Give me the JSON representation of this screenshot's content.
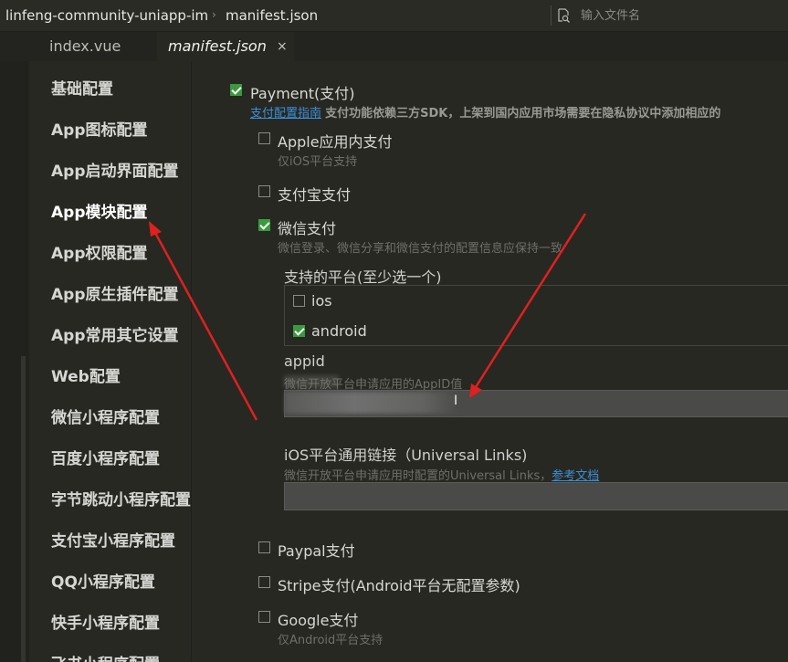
{
  "topbar": {
    "project": "linfeng-community-uniapp-im",
    "file": "manifest.json",
    "separator": "›",
    "search_placeholder": "输入文件名"
  },
  "tabs": [
    {
      "label": "index.vue"
    },
    {
      "label": "manifest.json",
      "close": "×"
    }
  ],
  "nav": {
    "items": [
      {
        "label": "基础配置"
      },
      {
        "label": "App图标配置"
      },
      {
        "label": "App启动界面配置"
      },
      {
        "label": "App模块配置",
        "active": true
      },
      {
        "label": "App权限配置"
      },
      {
        "label": "App原生插件配置"
      },
      {
        "label": "App常用其它设置"
      },
      {
        "label": "Web配置"
      },
      {
        "label": "微信小程序配置"
      },
      {
        "label": "百度小程序配置"
      },
      {
        "label": "字节跳动小程序配置"
      },
      {
        "label": "支付宝小程序配置"
      },
      {
        "label": "QQ小程序配置"
      },
      {
        "label": "快手小程序配置"
      },
      {
        "label": "飞书小程序配置"
      }
    ]
  },
  "payment": {
    "label": "Payment(支付)",
    "checked": true,
    "guide_link": "支付配置指南",
    "guide_text": "支付功能依赖三方SDK，上架到国内应用市场需要在隐私协议中添加相应的",
    "apple": {
      "label": "Apple应用内支付",
      "checked": false,
      "hint": "仅iOS平台支持"
    },
    "alipay": {
      "label": "支付宝支付",
      "checked": false
    },
    "wechat": {
      "label": "微信支付",
      "checked": true,
      "hint": "微信登录、微信分享和微信支付的配置信息应保持一致",
      "platforms_label": "支持的平台(至少选一个)",
      "platform_ios": {
        "label": "ios",
        "checked": false
      },
      "platform_android": {
        "label": "android",
        "checked": true
      },
      "appid_label": "appid",
      "appid_hint": "微信开放平台申请应用的AppID值",
      "appid_value": "",
      "cursor_glyph": "I",
      "ul_label": "iOS平台通用链接（Universal Links)",
      "ul_hint": "微信开放平台申请应用时配置的Universal Links，",
      "ul_link": "参考文档",
      "ul_value": ""
    },
    "paypal": {
      "label": "Paypal支付",
      "checked": false
    },
    "stripe": {
      "label": "Stripe支付(Android平台无配置参数)",
      "checked": false
    },
    "google": {
      "label": "Google支付",
      "checked": false,
      "hint": "仅Android平台支持"
    }
  },
  "colors": {
    "accent_check": "#3a9a3e",
    "link": "#3b8fd9",
    "annotation": "#e02020"
  }
}
